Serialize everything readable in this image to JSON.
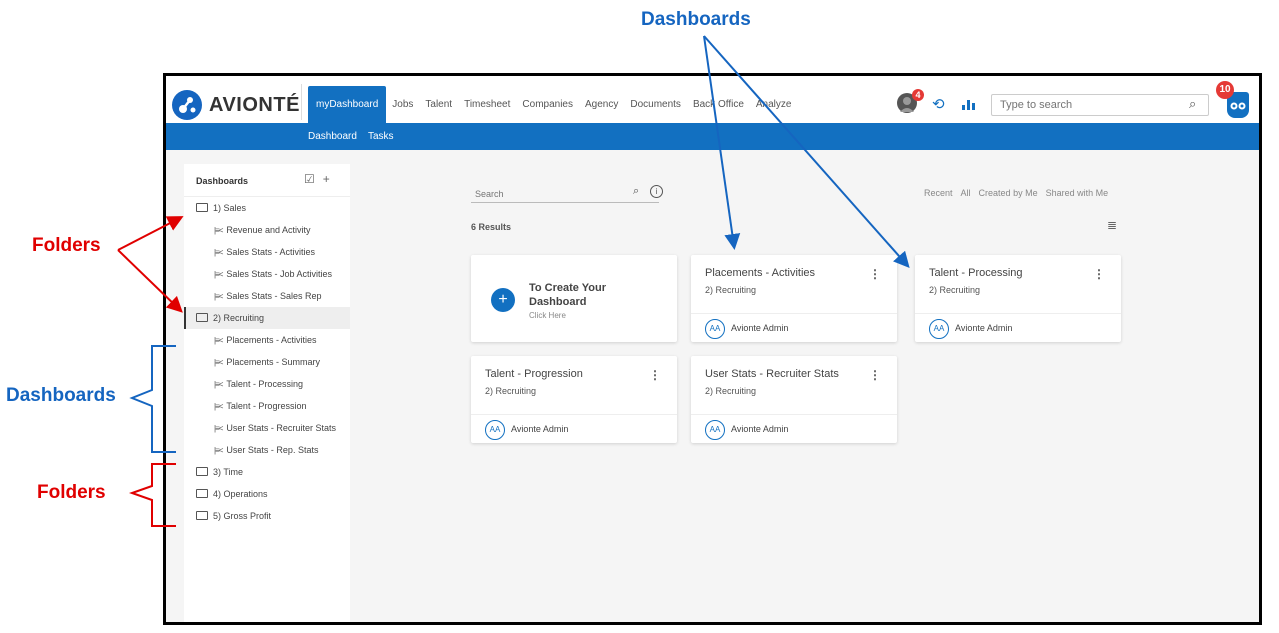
{
  "annotations": {
    "top": "Dashboards",
    "folders_upper": "Folders",
    "dashboards_left": "Dashboards",
    "folders_lower": "Folders"
  },
  "header": {
    "brand": "AVIONTÉ",
    "nav": [
      "myDashboard",
      "Jobs",
      "Talent",
      "Timesheet",
      "Companies",
      "Agency",
      "Documents",
      "Back Office",
      "Analyze"
    ],
    "subnav": [
      "Dashboard",
      "Tasks"
    ],
    "avatar_badge": "4",
    "owl_badge": "10",
    "search_placeholder": "Type to search"
  },
  "sidebar": {
    "title": "Dashboards",
    "tree": [
      {
        "type": "folder",
        "label": "1) Sales"
      },
      {
        "type": "dashboard",
        "label": "Revenue and Activity"
      },
      {
        "type": "dashboard",
        "label": "Sales Stats - Activities"
      },
      {
        "type": "dashboard",
        "label": "Sales Stats - Job Activities"
      },
      {
        "type": "dashboard",
        "label": "Sales Stats - Sales Rep"
      },
      {
        "type": "folder",
        "label": "2) Recruiting",
        "selected": true
      },
      {
        "type": "dashboard",
        "label": "Placements - Activities"
      },
      {
        "type": "dashboard",
        "label": "Placements - Summary"
      },
      {
        "type": "dashboard",
        "label": "Talent - Processing"
      },
      {
        "type": "dashboard",
        "label": "Talent - Progression"
      },
      {
        "type": "dashboard",
        "label": "User Stats - Recruiter Stats"
      },
      {
        "type": "dashboard",
        "label": "User Stats - Rep. Stats"
      },
      {
        "type": "folder",
        "label": "3) Time"
      },
      {
        "type": "folder",
        "label": "4) Operations"
      },
      {
        "type": "folder",
        "label": "5) Gross Profit"
      }
    ]
  },
  "main": {
    "search_placeholder": "Search",
    "filters": [
      "Recent",
      "All",
      "Created by Me",
      "Shared with Me"
    ],
    "results": "6 Results",
    "create_card": {
      "title": "To Create Your Dashboard",
      "hint": "Click Here"
    },
    "cards": [
      {
        "title": "Placements - Activities",
        "folder": "2) Recruiting",
        "initials": "AA",
        "owner": "Avionte Admin"
      },
      {
        "title": "Talent - Processing",
        "folder": "2) Recruiting",
        "initials": "AA",
        "owner": "Avionte Admin"
      },
      {
        "title": "Talent - Progression",
        "folder": "2) Recruiting",
        "initials": "AA",
        "owner": "Avionte Admin"
      },
      {
        "title": "User Stats - Recruiter Stats",
        "folder": "2) Recruiting",
        "initials": "AA",
        "owner": "Avionte Admin"
      }
    ]
  },
  "colors": {
    "accent": "#1270c1",
    "annotation_blue": "#1565c0",
    "annotation_red": "#e00000",
    "badge": "#e53935"
  }
}
